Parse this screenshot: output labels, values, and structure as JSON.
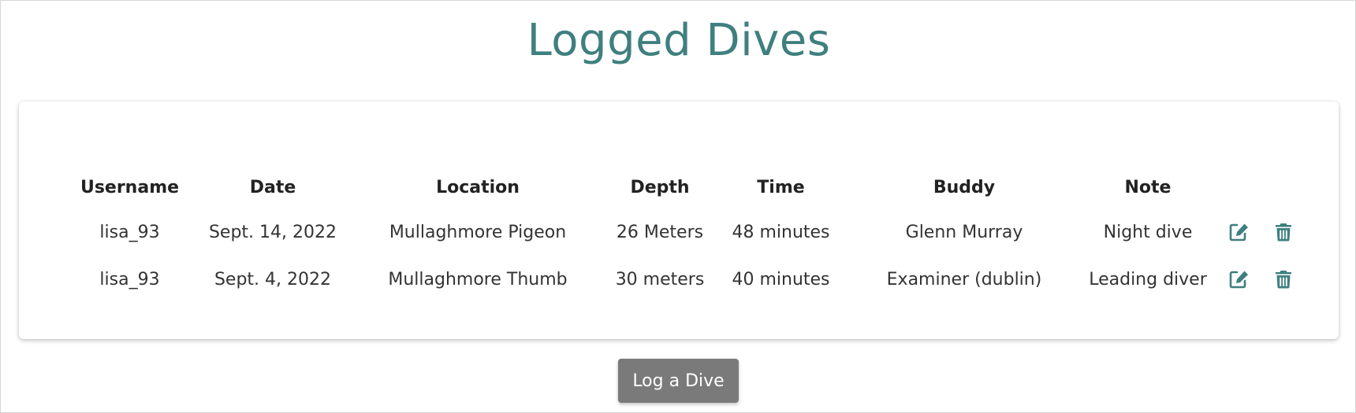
{
  "page": {
    "title": "Logged Dives"
  },
  "table": {
    "headers": {
      "username": "Username",
      "date": "Date",
      "location": "Location",
      "depth": "Depth",
      "time": "Time",
      "buddy": "Buddy",
      "note": "Note"
    },
    "rows": [
      {
        "username": "lisa_93",
        "date": "Sept. 14, 2022",
        "location": "Mullaghmore Pigeon",
        "depth": "26 Meters",
        "time": "48 minutes",
        "buddy": "Glenn Murray",
        "note": "Night dive"
      },
      {
        "username": "lisa_93",
        "date": "Sept. 4, 2022",
        "location": "Mullaghmore Thumb",
        "depth": "30 meters",
        "time": "40 minutes",
        "buddy": "Examiner (dublin)",
        "note": "Leading diver"
      }
    ],
    "row_icons": {
      "edit": "edit-icon",
      "delete": "trash-icon"
    }
  },
  "actions": {
    "log_dive_label": "Log a Dive"
  },
  "colors": {
    "accent": "#3f7f7f",
    "button_bg": "#7a7a7a",
    "button_text": "#ffffff"
  }
}
